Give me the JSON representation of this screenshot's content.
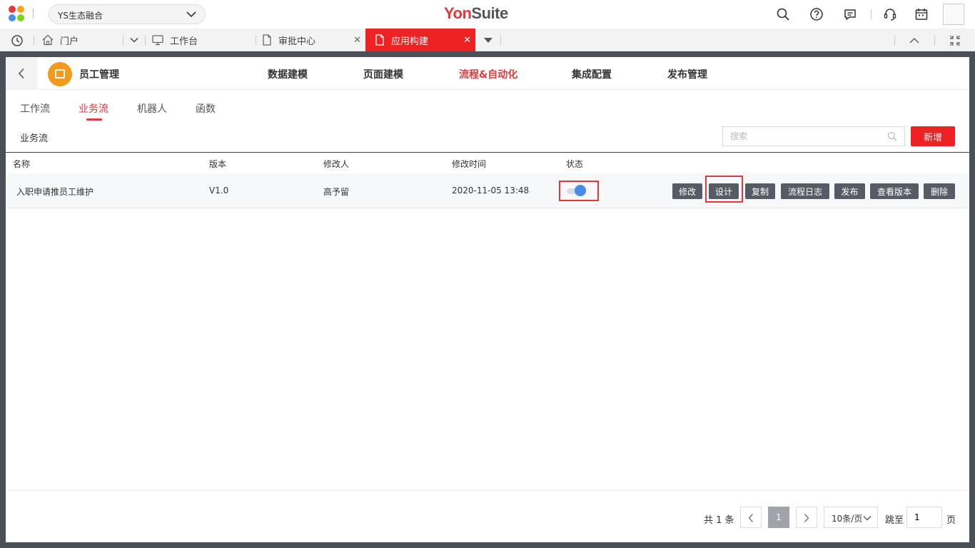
{
  "header": {
    "org_select": "YS生态融合",
    "brand_part1": "Yon",
    "brand_part2": "Suite"
  },
  "tabs": [
    {
      "label": "门户"
    },
    {
      "label": "工作台"
    },
    {
      "label": "审批中心"
    },
    {
      "label": "应用构建"
    }
  ],
  "app": {
    "name": "员工管理",
    "nav": [
      "数据建模",
      "页面建模",
      "流程&自动化",
      "集成配置",
      "发布管理"
    ]
  },
  "subtabs": [
    "工作流",
    "业务流",
    "机器人",
    "函数"
  ],
  "section_label": "业务流",
  "search": {
    "placeholder": "搜索"
  },
  "new_button": "新增",
  "table": {
    "columns": [
      "名称",
      "版本",
      "修改人",
      "修改时间",
      "状态"
    ],
    "rows": [
      {
        "name": "入职申请推员工维护",
        "version": "V1.0",
        "modifier": "高予留",
        "modified_time": "2020-11-05 13:48",
        "status_on": true
      }
    ],
    "actions": [
      "修改",
      "设计",
      "复制",
      "流程日志",
      "发布",
      "查看版本",
      "删除"
    ]
  },
  "pagination": {
    "total": "共 1 条",
    "current_page": "1",
    "page_size": "10条/页",
    "jump_label": "跳至",
    "jump_value": "1",
    "page_unit": "页"
  },
  "colors": {
    "accent": "#e4393c",
    "tab_active": "#ee2223",
    "action_button": "#555c66",
    "toggle_on": "#4a8ae8"
  }
}
